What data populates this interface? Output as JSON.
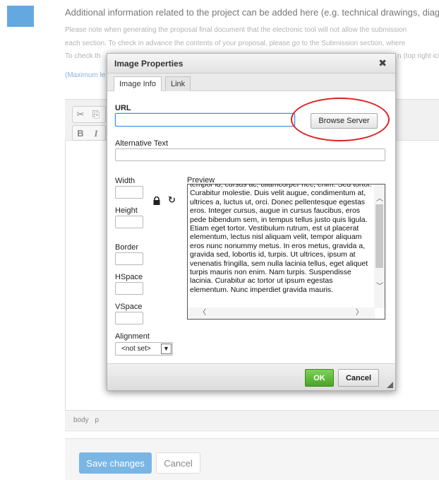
{
  "page": {
    "section_heading": "Additional information related to the project can be added here (e.g. technical drawings, diagrams",
    "note_lines": [
      "Please note when generating the proposal final document that the electronic tool will not allow the submission",
      "each section. To check in advance the contents of your proposal, please go to the Submission section, where",
      "To check th",
      "n (top right ico"
    ],
    "max_note": "(Maximum le",
    "status_path": "body p",
    "save_label": "Save changes",
    "cancel_label": "Cancel"
  },
  "editor_toolbar": {
    "cut_icon": "✂",
    "copy_icon": "⎘",
    "bold_label": "B",
    "italic_label": "I"
  },
  "dialog": {
    "title": "Image Properties",
    "close_icon": "✖",
    "tabs": [
      {
        "label": "Image Info"
      },
      {
        "label": "Link"
      }
    ],
    "url_label": "URL",
    "url_value": "",
    "browse_label": "Browse Server",
    "alt_label": "Alternative Text",
    "alt_value": "",
    "width_label": "Width",
    "height_label": "Height",
    "border_label": "Border",
    "hspace_label": "HSpace",
    "vspace_label": "VSpace",
    "alignment_label": "Alignment",
    "alignment_value": "<not set>",
    "preview_label": "Preview",
    "preview_text": "tempor id, cursus ac, ullamcorper nec, enim. Sed tortor. Curabitur molestie. Duis velit augue, condimentum at, ultrices a, luctus ut, orci. Donec pellentesque egestas eros. Integer cursus, augue in cursus faucibus, eros pede bibendum sem, in tempus tellus justo quis ligula. Etiam eget tortor. Vestibulum rutrum, est ut placerat elementum, lectus nisl aliquam velit, tempor aliquam eros nunc nonummy metus. In eros metus, gravida a, gravida sed, lobortis id, turpis. Ut ultrices, ipsum at venenatis fringilla, sem nulla lacinia tellus, eget aliquet turpis mauris non enim. Nam turpis. Suspendisse lacinia. Curabitur ac tortor ut ipsum egestas elementum. Nunc imperdiet gravida mauris.",
    "ok_label": "OK",
    "cancel_label": "Cancel",
    "reset_icon": "↻"
  },
  "colors": {
    "ok_green": "#4ba424",
    "highlight_red": "#e02020",
    "save_blue": "#7ab6e4"
  }
}
